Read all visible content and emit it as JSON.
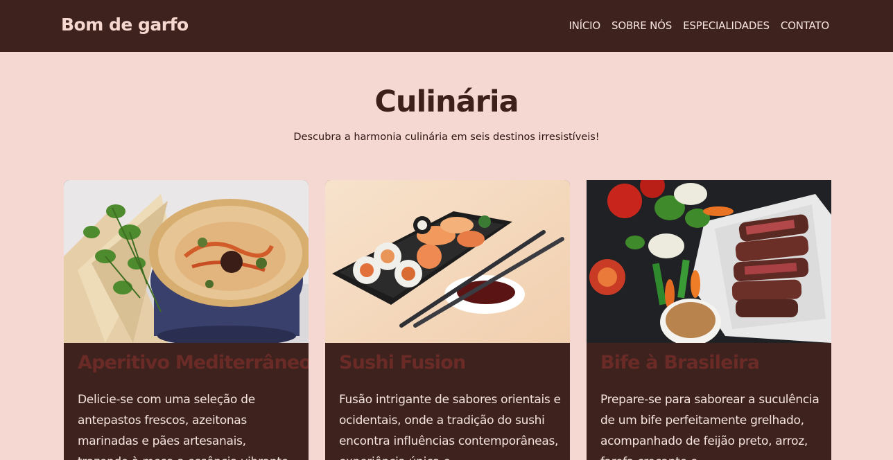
{
  "navbar": {
    "brand": "Bom de garfo",
    "links": [
      "INÍCIO",
      "SOBRE NÓS",
      "ESPECIALIDADES",
      "CONTATO"
    ]
  },
  "hero": {
    "title": "Culinária",
    "subtitle": "Descubra a harmonia culinária em seis destinos irresistíveis!"
  },
  "cards": [
    {
      "image": "hummus-appetizer-photo",
      "title": "Aperitivo Mediterrâneo",
      "text": "Delicie-se com uma seleção de antepastos frescos, azeitonas marinadas e pães artesanais, trazendo à mesa a essência vibrante"
    },
    {
      "image": "sushi-tray-photo",
      "title": "Sushi Fusion",
      "text": "Fusão intrigante de sabores orientais e ocidentais, onde a tradição do sushi encontra influências contemporâneas, experiência única e"
    },
    {
      "image": "grilled-steak-photo",
      "title": "Bife à Brasileira",
      "text": "Prepare-se para saborear a suculência de um bife perfeitamente grelhado, acompanhado de feijão preto, arroz, farofa crocante e"
    }
  ],
  "colors": {
    "navbar_bg": "#3e221e",
    "page_bg": "#f4d8d1",
    "card_bg": "#3e221e",
    "card_title": "#6a2b27",
    "brand": "#f6d7cf"
  }
}
